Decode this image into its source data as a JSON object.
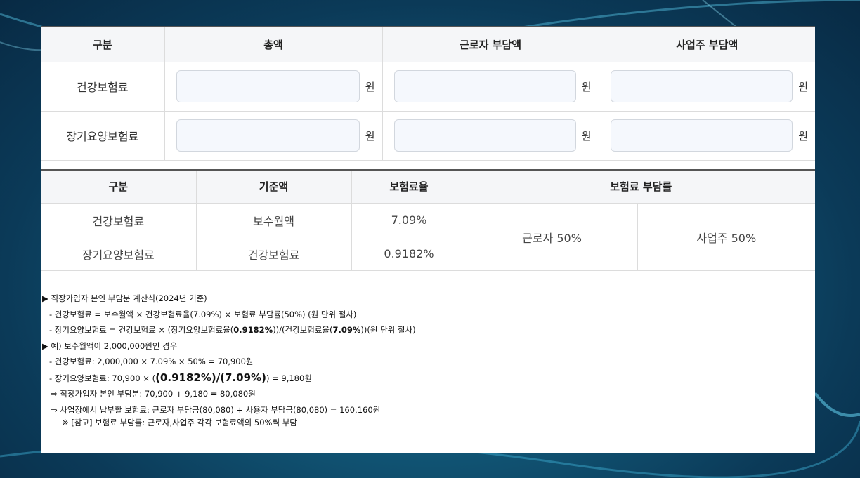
{
  "table1": {
    "headers": [
      "구분",
      "총액",
      "근로자 부담액",
      "사업주 부담액"
    ],
    "rows": [
      {
        "label": "건강보험료",
        "unit": "원"
      },
      {
        "label": "장기요양보험료",
        "unit": "원"
      }
    ]
  },
  "table2": {
    "headers": [
      "구분",
      "기준액",
      "보험료율",
      "보험료 부담률"
    ],
    "rows": [
      {
        "label": "건강보험료",
        "base": "보수월액",
        "rate": "7.09%"
      },
      {
        "label": "장기요양보험료",
        "base": "건강보험료",
        "rate": "0.9182%"
      }
    ],
    "worker_share": "근로자 50%",
    "employer_share": "사업주 50%"
  },
  "notes": {
    "line1": "▶ 직장가입자 본인 부담분 계산식(2024년 기준)",
    "line2": "- 건강보험료 = 보수월액 × 건강보험료율(7.09%) × 보험료 부담률(50%) (원 단위 절사)",
    "line3a": "- 장기요양보험료 = 건강보험료 × (장기요양보험료율(",
    "line3b": "0.9182%",
    "line3c": "))/(건강보험료율(",
    "line3d": "7.09%",
    "line3e": "))(원 단위 절사)",
    "line4": "▶ 예) 보수월액이 2,000,000원인 경우",
    "line5": "- 건강보험료: 2,000,000 × 7.09% × 50% = 70,900원",
    "line6a": "- 장기요양보험료: 70,900 × (",
    "line6b": "(0.9182%)/(7.09%)",
    "line6c": ") = 9,180원",
    "line7": "⇒ 직장가입자 본인 부담분: 70,900 + 9,180 = 80,080원",
    "line8": "⇒ 사업장에서 납부할 보험료: 근로자 부담금(80,080) + 사용자 부담금(80,080) = 160,160원",
    "line9": "※ [참고] 보험료 부담률: 근로자,사업주 각각 보험료액의 50%씩 부담"
  }
}
